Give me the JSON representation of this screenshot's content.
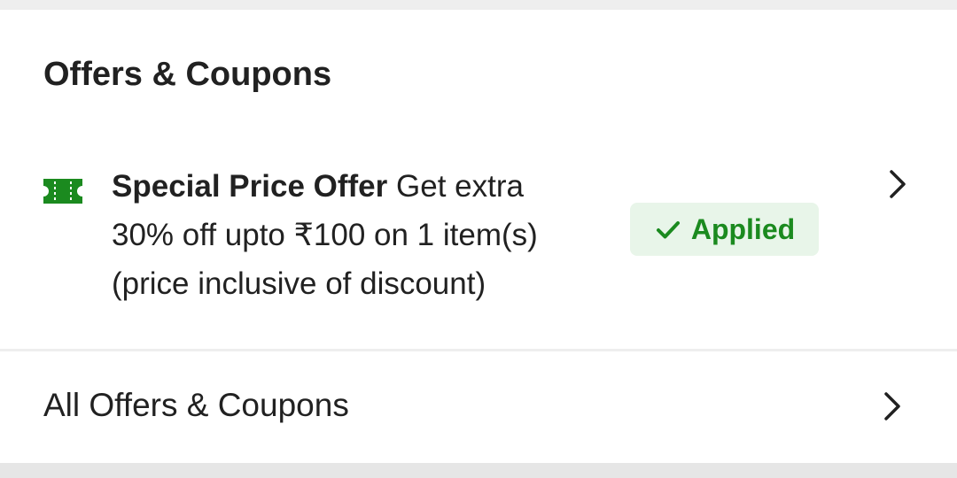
{
  "section": {
    "title": "Offers & Coupons"
  },
  "offer": {
    "title": "Special Price Offer",
    "description_line1_rest": "Get extra",
    "description_line2": "30% off upto  ₹100 on 1 item(s)",
    "description_line3": "(price inclusive of discount)",
    "icon": "ticket-icon",
    "status_label": "Applied",
    "status_icon": "check-icon",
    "status_color": "#1b8a1f",
    "status_bg": "#e8f5e9",
    "icon_color": "#1b8a1f"
  },
  "all_offers": {
    "label": "All Offers & Coupons"
  }
}
